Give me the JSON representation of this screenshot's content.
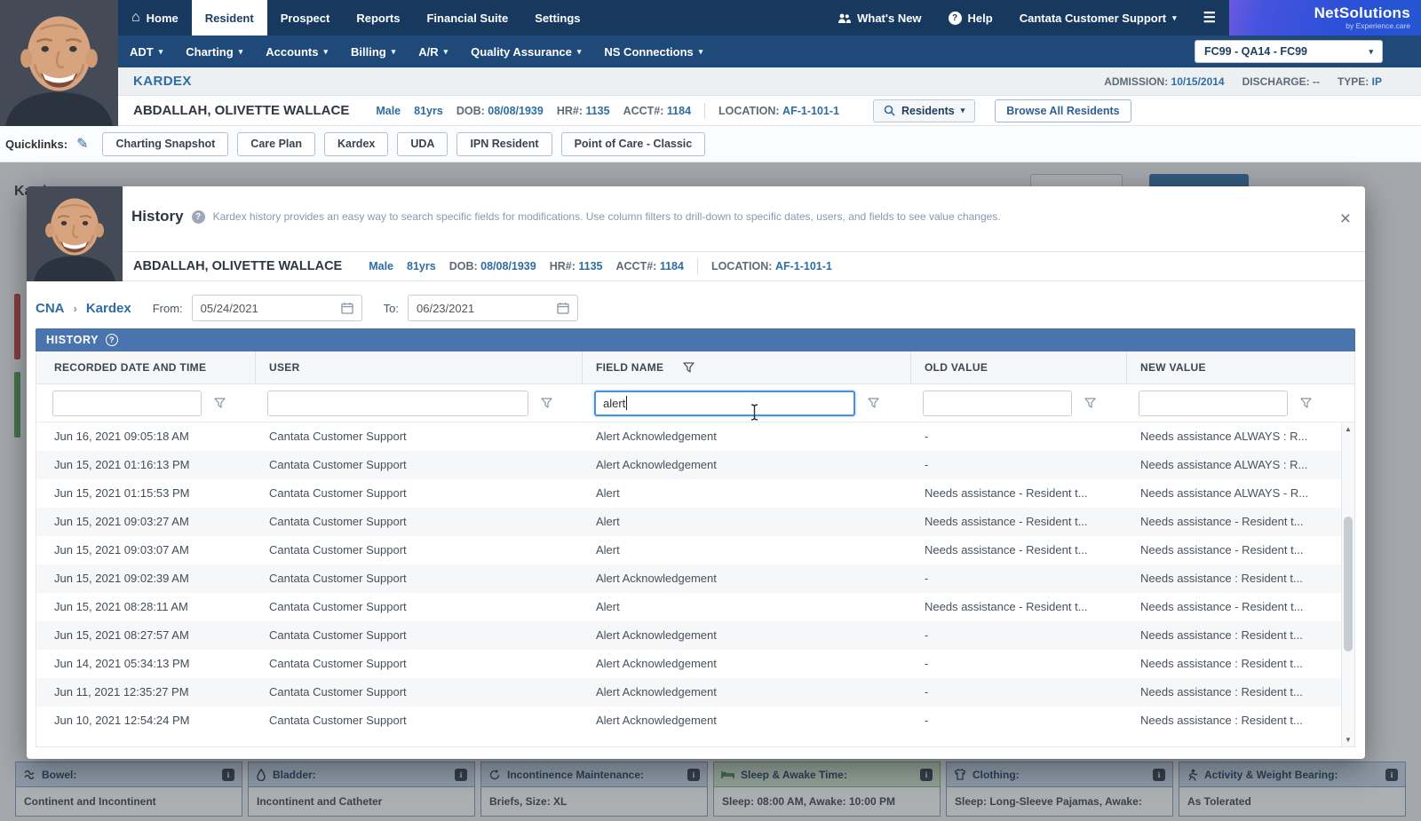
{
  "topnav": {
    "items": [
      "Home",
      "Resident",
      "Prospect",
      "Reports",
      "Financial Suite",
      "Settings"
    ],
    "whats_new": "What's New",
    "help": "Help",
    "support": "Cantata Customer Support",
    "logo_name": "NetSolutions",
    "logo_tagline": "by Experience.care"
  },
  "subnav": {
    "items": [
      "ADT",
      "Charting",
      "Accounts",
      "Billing",
      "A/R",
      "Quality Assurance",
      "NS Connections"
    ],
    "facility": "FC99 - QA14 - FC99"
  },
  "page_header": {
    "title": "KARDEX",
    "admission_label": "ADMISSION:",
    "admission_value": "10/15/2014",
    "discharge_label": "DISCHARGE:",
    "discharge_value": "--",
    "type_label": "TYPE:",
    "type_value": "IP"
  },
  "patient": {
    "name": "ABDALLAH, OLIVETTE WALLACE",
    "sex": "Male",
    "age": "81yrs",
    "dob_label": "DOB:",
    "dob": "08/08/1939",
    "hr_label": "HR#:",
    "hr": "1135",
    "acct_label": "ACCT#:",
    "acct": "1184",
    "location_label": "LOCATION:",
    "location": "AF-1-101-1",
    "residents_button": "Residents",
    "browse_button": "Browse All Residents"
  },
  "quicklinks": {
    "label": "Quicklinks:",
    "items": [
      "Charting Snapshot",
      "Care Plan",
      "Kardex",
      "UDA",
      "IPN Resident",
      "Point of Care - Classic"
    ]
  },
  "modal": {
    "title": "History",
    "help_text": "Kardex history provides an easy way to search specific fields for modifications. Use column filters to drill-down to specific dates, users, and fields to see value changes.",
    "breadcrumb_parent": "CNA",
    "breadcrumb_current": "Kardex",
    "from_label": "From:",
    "from_value": "05/24/2021",
    "to_label": "To:",
    "to_value": "06/23/2021",
    "section_title": "HISTORY",
    "columns": [
      "RECORDED DATE AND TIME",
      "USER",
      "FIELD NAME",
      "OLD VALUE",
      "NEW VALUE"
    ],
    "filter_value": "alert",
    "rows": [
      {
        "date": "Jun 16, 2021 09:05:18 AM",
        "user": "Cantata Customer Support",
        "field": "Alert Acknowledgement",
        "old": "-",
        "new": "Needs assistance ALWAYS : R..."
      },
      {
        "date": "Jun 15, 2021 01:16:13 PM",
        "user": "Cantata Customer Support",
        "field": "Alert Acknowledgement",
        "old": "-",
        "new": "Needs assistance ALWAYS : R..."
      },
      {
        "date": "Jun 15, 2021 01:15:53 PM",
        "user": "Cantata Customer Support",
        "field": "Alert",
        "old": "Needs assistance - Resident t...",
        "new": "Needs assistance ALWAYS - R..."
      },
      {
        "date": "Jun 15, 2021 09:03:27 AM",
        "user": "Cantata Customer Support",
        "field": "Alert",
        "old": "Needs assistance - Resident t...",
        "new": "Needs assistance - Resident t..."
      },
      {
        "date": "Jun 15, 2021 09:03:07 AM",
        "user": "Cantata Customer Support",
        "field": "Alert",
        "old": "Needs assistance - Resident t...",
        "new": "Needs assistance - Resident t..."
      },
      {
        "date": "Jun 15, 2021 09:02:39 AM",
        "user": "Cantata Customer Support",
        "field": "Alert Acknowledgement",
        "old": "-",
        "new": "Needs assistance : Resident t..."
      },
      {
        "date": "Jun 15, 2021 08:28:11 AM",
        "user": "Cantata Customer Support",
        "field": "Alert",
        "old": "Needs assistance - Resident t...",
        "new": "Needs assistance - Resident t..."
      },
      {
        "date": "Jun 15, 2021 08:27:57 AM",
        "user": "Cantata Customer Support",
        "field": "Alert Acknowledgement",
        "old": "-",
        "new": "Needs assistance : Resident t..."
      },
      {
        "date": "Jun 14, 2021 05:34:13 PM",
        "user": "Cantata Customer Support",
        "field": "Alert Acknowledgement",
        "old": "-",
        "new": "Needs assistance : Resident t..."
      },
      {
        "date": "Jun 11, 2021 12:35:27 PM",
        "user": "Cantata Customer Support",
        "field": "Alert Acknowledgement",
        "old": "-",
        "new": "Needs assistance : Resident t..."
      },
      {
        "date": "Jun 10, 2021 12:54:24 PM",
        "user": "Cantata Customer Support",
        "field": "Alert Acknowledgement",
        "old": "-",
        "new": "Needs assistance : Resident t..."
      }
    ]
  },
  "background": {
    "kardex_title": "Kardex",
    "cards": [
      {
        "title": "Bowel:",
        "body": "Continent and Incontinent"
      },
      {
        "title": "Bladder:",
        "body": "Incontinent and Catheter"
      },
      {
        "title": "Incontinence Maintenance:",
        "body": "Briefs, Size: XL"
      },
      {
        "title": "Sleep & Awake Time:",
        "body": "Sleep: 08:00 AM, Awake: 10:00 PM"
      },
      {
        "title": "Clothing:",
        "body": "Sleep: Long-Sleeve Pajamas, Awake:"
      },
      {
        "title": "Activity & Weight Bearing:",
        "body": "As Tolerated"
      }
    ]
  }
}
